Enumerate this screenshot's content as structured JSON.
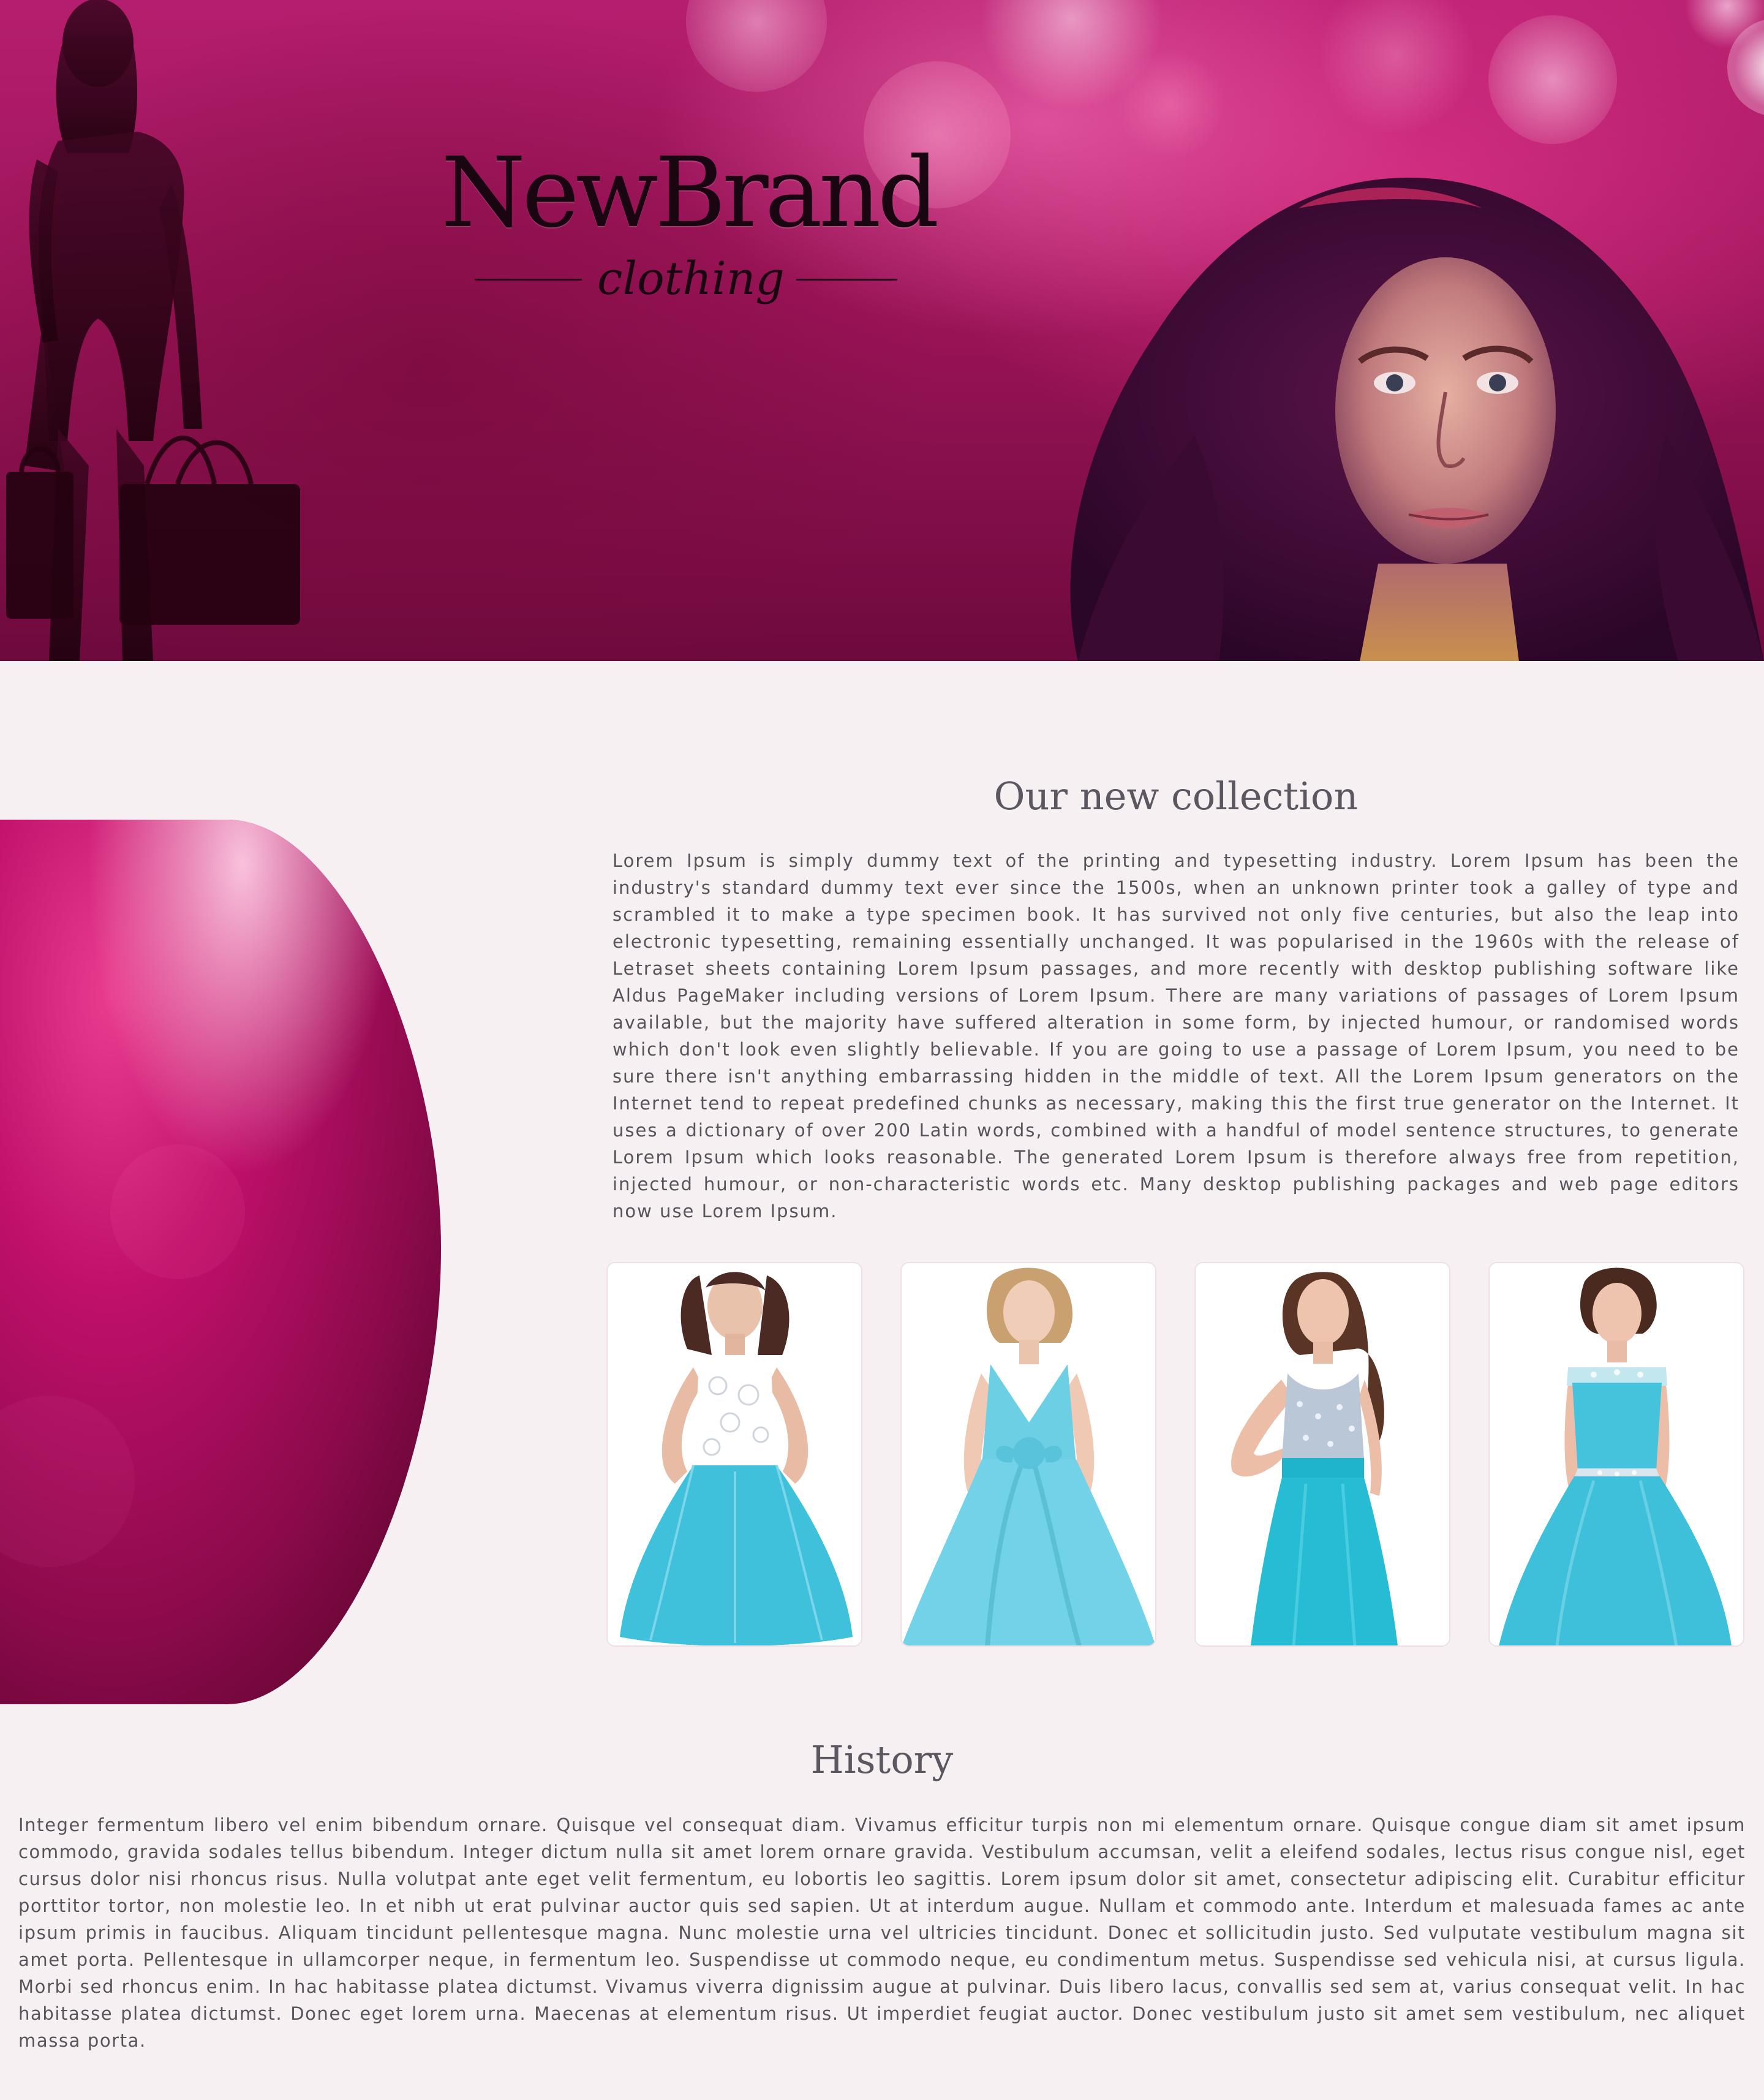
{
  "brand": {
    "name": "NewBrand",
    "tagline": "clothing"
  },
  "colors": {
    "background": "#f6f0f2",
    "hero_magenta": "#b51e6e",
    "accent_crimson": "#c0106a",
    "dress_blue": "#3fc1dc",
    "text": "#57535a"
  },
  "collection": {
    "title": "Our new collection",
    "body": "Lorem Ipsum is simply dummy text of the printing and typesetting industry. Lorem Ipsum has been the industry's standard dummy text ever since the 1500s, when an unknown printer took a galley of type and scrambled it to make a type specimen book. It has survived not only five centuries, but also the leap into electronic typesetting, remaining essentially unchanged. It was popularised in the 1960s with the release of Letraset sheets containing Lorem Ipsum passages, and more recently with desktop publishing software like Aldus PageMaker including versions of Lorem Ipsum. There are many variations of passages of Lorem Ipsum available, but the majority have suffered alteration in some form, by injected humour, or randomised words which don't look even slightly believable. If you are going to use a passage of Lorem Ipsum, you need to be sure there isn't anything embarrassing hidden in the middle of text. All the Lorem Ipsum generators on the Internet tend to repeat predefined chunks as necessary, making this the first true generator on the Internet. It uses a dictionary of over 200 Latin words, combined with a handful of model sentence structures, to generate Lorem Ipsum which looks reasonable. The generated Lorem Ipsum is therefore always free from repetition, injected humour, or non-characteristic words etc. Many desktop publishing packages and web page editors now use Lorem Ipsum.",
    "products": [
      {
        "icon": "dress-lace-tutu-image"
      },
      {
        "icon": "dress-vneck-bow-image"
      },
      {
        "icon": "dress-sequin-bodice-image"
      },
      {
        "icon": "dress-capsleeve-image"
      }
    ]
  },
  "history": {
    "title": "History",
    "body": "Integer fermentum libero vel enim bibendum ornare. Quisque vel consequat diam. Vivamus efficitur turpis non mi elementum ornare. Quisque congue diam sit amet ipsum commodo, gravida sodales tellus bibendum. Integer dictum nulla sit amet lorem ornare gravida. Vestibulum accumsan, velit a eleifend sodales, lectus risus congue nisl, eget cursus dolor nisi rhoncus risus. Nulla volutpat ante eget velit fermentum, eu lobortis leo sagittis. Lorem ipsum dolor sit amet, consectetur adipiscing elit. Curabitur efficitur porttitor tortor, non molestie leo. In et nibh ut erat pulvinar auctor quis sed sapien. Ut at interdum augue. Nullam et commodo ante. Interdum et malesuada fames ac ante ipsum primis in faucibus. Aliquam tincidunt pellentesque magna. Nunc molestie urna vel ultricies tincidunt. Donec et sollicitudin justo. Sed vulputate vestibulum magna sit amet porta. Pellentesque in ullamcorper neque, in fermentum leo. Suspendisse ut commodo neque, eu condimentum metus. Suspendisse sed vehicula nisi, at cursus ligula. Morbi sed rhoncus enim. In hac habitasse platea dictumst. Vivamus viverra dignissim augue at pulvinar. Duis libero lacus, convallis sed sem at, varius consequat velit. In hac habitasse platea dictumst. Donec eget lorem urna. Maecenas at elementum risus. Ut imperdiet feugiat auctor. Donec vestibulum justo sit amet sem vestibulum, nec aliquet massa porta."
  }
}
